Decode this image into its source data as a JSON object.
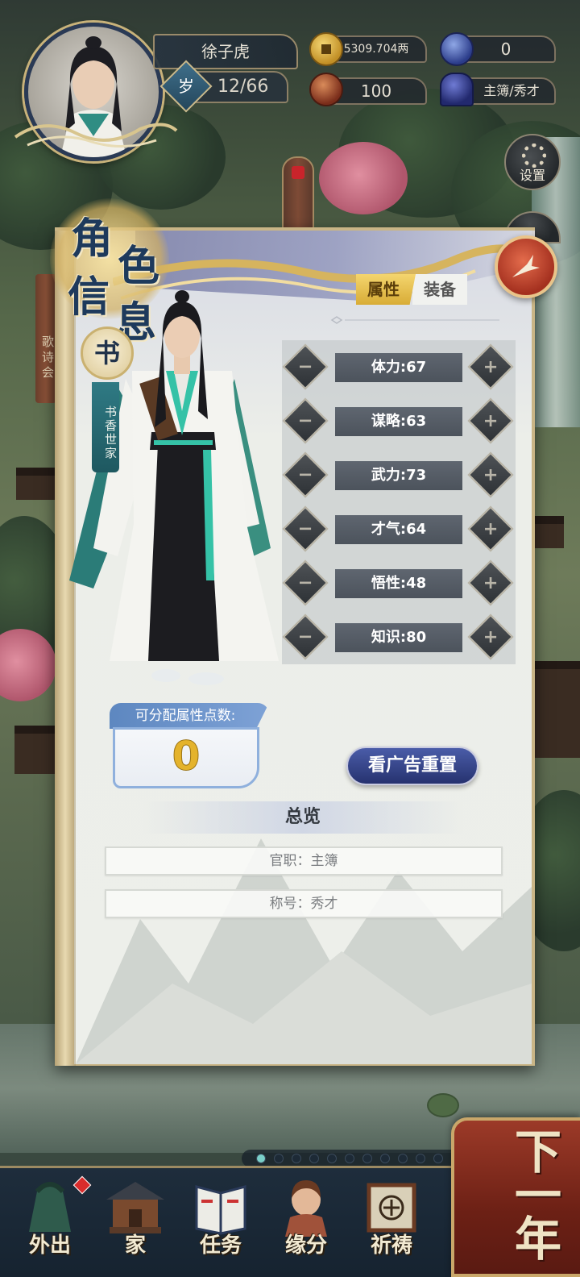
{
  "player": {
    "name": "徐子虎",
    "age_badge": "岁",
    "age": "12/66"
  },
  "resources": {
    "money": "5309.704两",
    "gems": "0",
    "reputation": "100",
    "rank": "主簿/秀才"
  },
  "side_buttons": {
    "settings": "设置"
  },
  "background_scroll": {
    "label": "歌诗会"
  },
  "panel": {
    "title_chars": [
      "角",
      "色",
      "信",
      "息"
    ],
    "family_badge": "书",
    "family_tag": "书香世家",
    "tabs": [
      {
        "label": "属性",
        "active": true
      },
      {
        "label": "装备",
        "active": false
      }
    ],
    "attributes": [
      {
        "label": "体力:67"
      },
      {
        "label": "谋略:63"
      },
      {
        "label": "武力:73"
      },
      {
        "label": "才气:64"
      },
      {
        "label": "悟性:48"
      },
      {
        "label": "知识:80"
      }
    ],
    "points": {
      "title": "可分配属性点数:",
      "value": "0"
    },
    "reset_button": "看广告重置",
    "overview": {
      "title": "总览",
      "rows": [
        "官职：主簿",
        "称号：秀才"
      ]
    }
  },
  "bottom_nav": {
    "items": [
      {
        "label": "外出",
        "icon": "outing-icon",
        "alert": true
      },
      {
        "label": "家",
        "icon": "house-icon",
        "alert": false
      },
      {
        "label": "任务",
        "icon": "task-book-icon",
        "alert": false
      },
      {
        "label": "缘分",
        "icon": "fate-icon",
        "alert": false
      },
      {
        "label": "祈祷",
        "icon": "pray-icon",
        "alert": false
      }
    ],
    "next_year": "下一年",
    "page_dot_count": 12,
    "page_dot_active": 0
  },
  "colors": {
    "accent_gold": "#e4b32c",
    "close_red": "#c44a32",
    "attr_bar": "#565d66",
    "reset_blue": "#2f3c80",
    "teal_tag": "#2f7a84"
  }
}
